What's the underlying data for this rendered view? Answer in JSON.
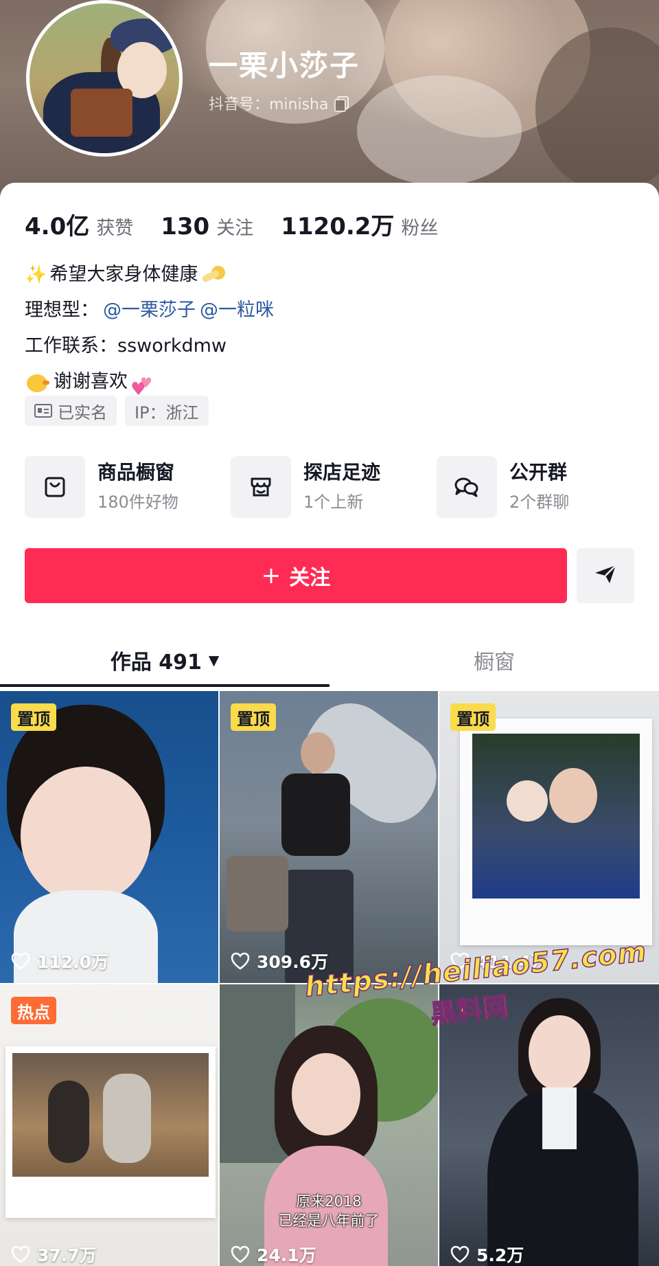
{
  "profile": {
    "nickname": "一栗小莎子",
    "account_id": "抖音号：minisha"
  },
  "stats": [
    {
      "value": "4.0亿",
      "label": "获赞"
    },
    {
      "value": "130",
      "label": "关注"
    },
    {
      "value": "1120.2万",
      "label": "粉丝"
    }
  ],
  "bio": {
    "line1": "希望大家身体健康",
    "line2_prefix": "理想型：",
    "mention1": "@一栗莎子",
    "mention2": "@一粒咪",
    "line3": "工作联系：ssworkdmw",
    "line4": "谢谢喜欢"
  },
  "tags": {
    "verified": "已实名",
    "ip": "IP：浙江"
  },
  "services": [
    {
      "title": "商品橱窗",
      "subtitle": "180件好物",
      "icon": "bag-icon"
    },
    {
      "title": "探店足迹",
      "subtitle": "1个上新",
      "icon": "store-icon"
    },
    {
      "title": "公开群",
      "subtitle": "2个群聊",
      "icon": "chat-bubbles-icon"
    }
  ],
  "actions": {
    "follow_plus": "+",
    "follow_label": "关注",
    "share_icon": "send-icon"
  },
  "tabs": {
    "works_label": "作品 491",
    "works_caret": "▼",
    "window_label": "橱窗"
  },
  "videos": [
    {
      "badge": "置顶",
      "likes": "112.0万"
    },
    {
      "badge": "置顶",
      "likes": "309.6万"
    },
    {
      "badge": "置顶",
      "likes": "411.4万"
    },
    {
      "badge": "热点",
      "likes": "37.7万"
    },
    {
      "badge": "",
      "likes": "24.1万",
      "caption_line1": "原来2018",
      "caption_line2": "已经是八年前了"
    },
    {
      "badge": "",
      "likes": "5.2万"
    }
  ],
  "watermark": {
    "url": "https://heiliao57.com",
    "name": "黑料网"
  },
  "colors": {
    "accent": "#fe2c55",
    "pin_badge": "#fadb4b",
    "hot_badge": "#fe6b34",
    "mention": "#2c5aa0"
  }
}
